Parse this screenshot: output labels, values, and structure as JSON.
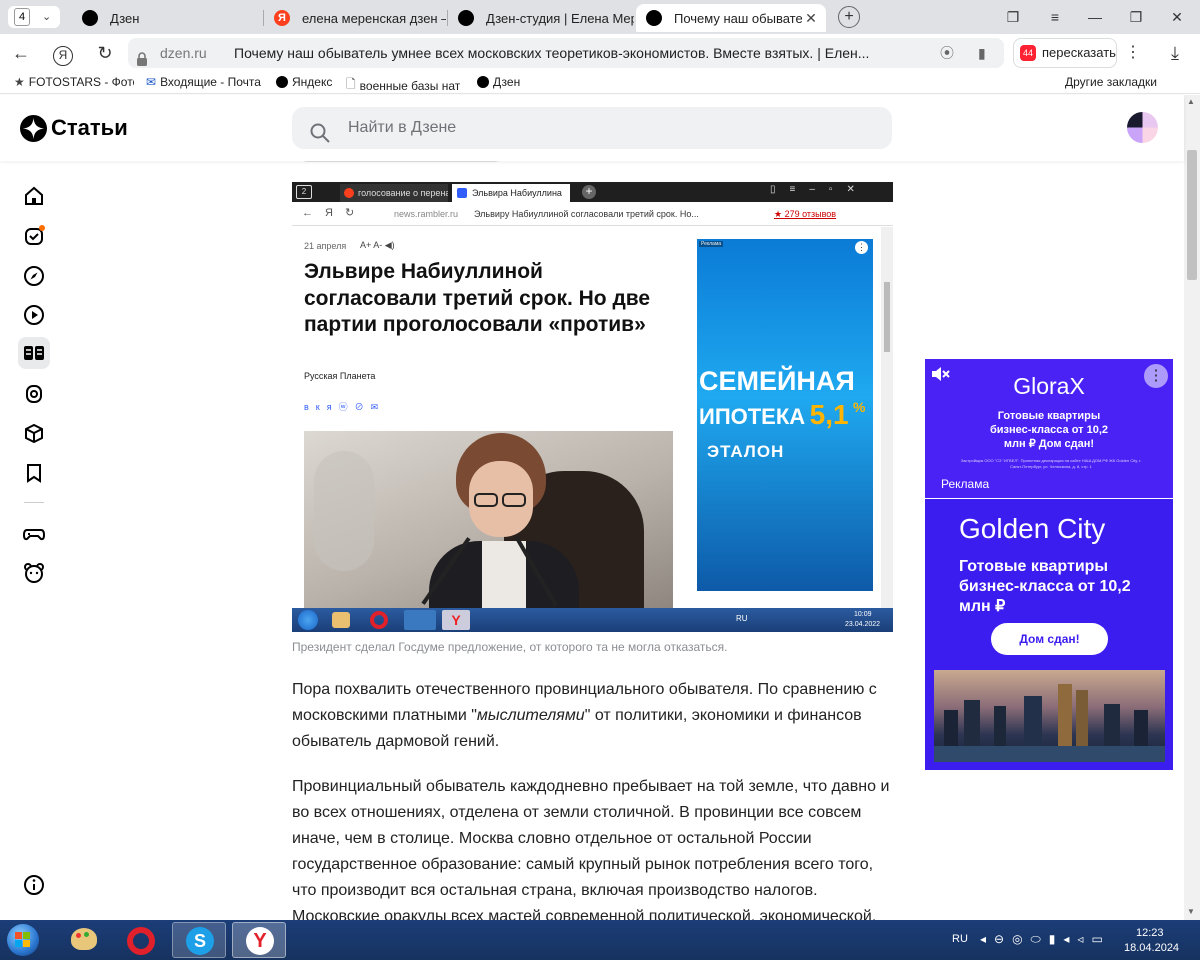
{
  "browser": {
    "tab_count": "4",
    "tabs": [
      {
        "title": "Дзен",
        "active": false
      },
      {
        "title": "елена меренская дзен — Я",
        "active": false
      },
      {
        "title": "Дзен-студия | Елена Мере",
        "active": false
      },
      {
        "title": "Почему наш обывател",
        "active": true
      }
    ],
    "new_tab": "+",
    "address": {
      "domain": "dzen.ru",
      "title": "Почему наш обыватель умнее всех московских теоретиков-экономистов. Вместе взятых. | Елен..."
    },
    "retell_label": "пересказать",
    "retell_badge": "44",
    "bookmarks": [
      {
        "label": "FOTOSTARS - Фото",
        "icon": "star-icon"
      },
      {
        "label": "Входящие - Почта",
        "icon": "mail-icon"
      },
      {
        "label": "Яндекс",
        "icon": "dzen-icon"
      },
      {
        "label": "военные базы нат",
        "icon": "document-icon"
      },
      {
        "label": "Дзен",
        "icon": "dzen-icon"
      }
    ],
    "other_bookmarks": "Другие закладки"
  },
  "dzen": {
    "logo": "Статьи",
    "search_placeholder": "Найти в Дзене"
  },
  "article": {
    "embedded": {
      "tab1": "голосование о переназн",
      "tab2": "Эльвира Набиуллина",
      "domain": "news.rambler.ru",
      "addr_title": "Эльвиру Набиуллиной согласовали третий срок. Но...",
      "reviews": "★ 279 отзывов",
      "date": "21 апреля",
      "headline": "Эльвире Набиуллиной согласовали третий срок. Но две партии проголосовали «против»",
      "source": "Русская Планета",
      "ad_badge": "Реклама",
      "ad_line1": "СЕМЕЙНАЯ",
      "ad_line2": "ИПОТЕКА",
      "ad_rate": "5,1",
      "ad_pct": "%",
      "ad_brand": "ЭТАЛОН",
      "lang": "RU",
      "time": "10:09",
      "date2": "23.04.2022"
    },
    "caption": "Президент сделал Госдуме предложение, от которого та не могла отказаться.",
    "p1_before": "Пора похвалить отечественного провинциального обывателя. По сравнению с московскими платными \"",
    "p1_em": "мыслителями",
    "p1_after": "\" от политики, экономики и финансов обыватель дармовой гений.",
    "p2": "Провинциальный обыватель каждодневно пребывает на той земле, что давно и во всех отношениях, отделена от земли столичной. В провинции все совсем иначе, чем в столице. Москва словно отдельное от остальной России государственное образование: самый крупный рынок потребления всего того, что производит вся остальная страна, включая производство налогов. Московские оракулы всех мастей современной политической, экономической,"
  },
  "ads": {
    "ad1": {
      "brand": "GloraX",
      "text": "Готовые квартиры бизнес-класса от 10,2 млн ₽ Дом сдан!",
      "fine": "Застройщик ООО \"СЗ \"ИГВЕЛ\". Проектная декларация на сайте НАШ.ДОМ.РФ ЖК Golden City, г. Санкт-Петербург, ул. Челюскина, д. 8, стр. 1",
      "label": "Реклама"
    },
    "ad2": {
      "title": "Golden City",
      "text": "Готовые квартиры бизнес-класса от 10,2 млн ₽",
      "button": "Дом сдан!"
    }
  },
  "taskbar": {
    "lang": "RU",
    "time": "12:23",
    "date": "18.04.2024"
  },
  "colors": {
    "ad_bg": "#4a22f5",
    "accent_orange": "#ff6c00"
  }
}
